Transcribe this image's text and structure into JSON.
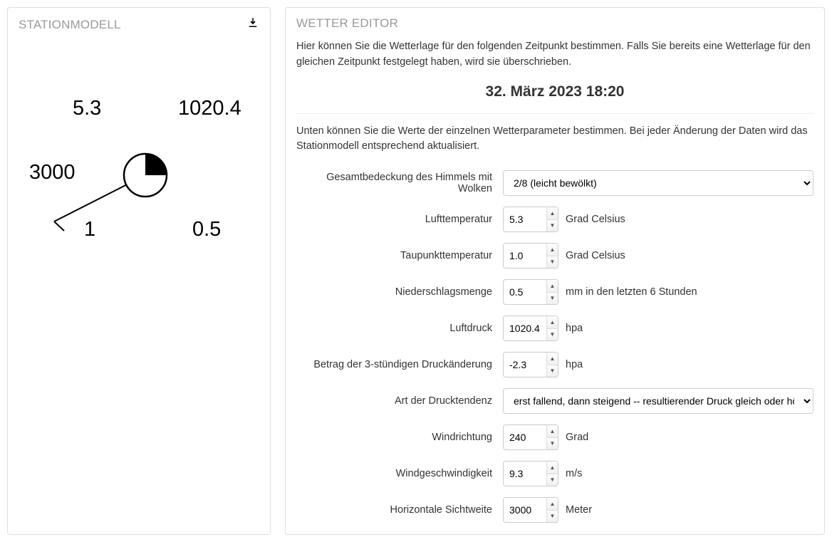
{
  "left": {
    "title": "STATIONMODELL",
    "values": {
      "temp": "5.3",
      "pressure": "1020.4",
      "visibility": "3000",
      "dewpoint": "1",
      "precip": "0.5"
    }
  },
  "right": {
    "title": "WETTER EDITOR",
    "intro": "Hier können Sie die Wetterlage für den folgenden Zeitpunkt bestimmen. Falls Sie bereits eine Wetterlage für den gleichen Zeitpunkt festgelegt haben, wird sie überschrieben.",
    "datetime": "32. März 2023 18:20",
    "instr": "Unten können Sie die Werte der einzelnen Wetterparameter bestimmen. Bei jeder Änderung der Daten wird das Stationmodell entsprechend aktualisiert.",
    "fields": {
      "cloudcover": {
        "label": "Gesamtbedeckung des Himmels mit Wolken",
        "selected": "2/8 (leicht bewölkt)"
      },
      "airtemp": {
        "label": "Lufttemperatur",
        "value": "5.3",
        "unit": "Grad Celsius"
      },
      "dewpoint": {
        "label": "Taupunkttemperatur",
        "value": "1.0",
        "unit": "Grad Celsius"
      },
      "precip": {
        "label": "Niederschlagsmenge",
        "value": "0.5",
        "unit": "mm in den letzten 6 Stunden"
      },
      "pressure": {
        "label": "Luftdruck",
        "value": "1020.4",
        "unit": "hpa"
      },
      "pressurechange": {
        "label": "Betrag der 3-stündigen Druckänderung",
        "value": "-2.3",
        "unit": "hpa"
      },
      "pressuretrend": {
        "label": "Art der Drucktendenz",
        "selected": "erst fallend, dann steigend -- resultierender Druck gleich oder höher"
      },
      "winddir": {
        "label": "Windrichtung",
        "value": "240",
        "unit": "Grad"
      },
      "windspeed": {
        "label": "Windgeschwindigkeit",
        "value": "9.3",
        "unit": "m/s"
      },
      "visibility": {
        "label": "Horizontale Sichtweite",
        "value": "3000",
        "unit": "Meter"
      }
    }
  }
}
